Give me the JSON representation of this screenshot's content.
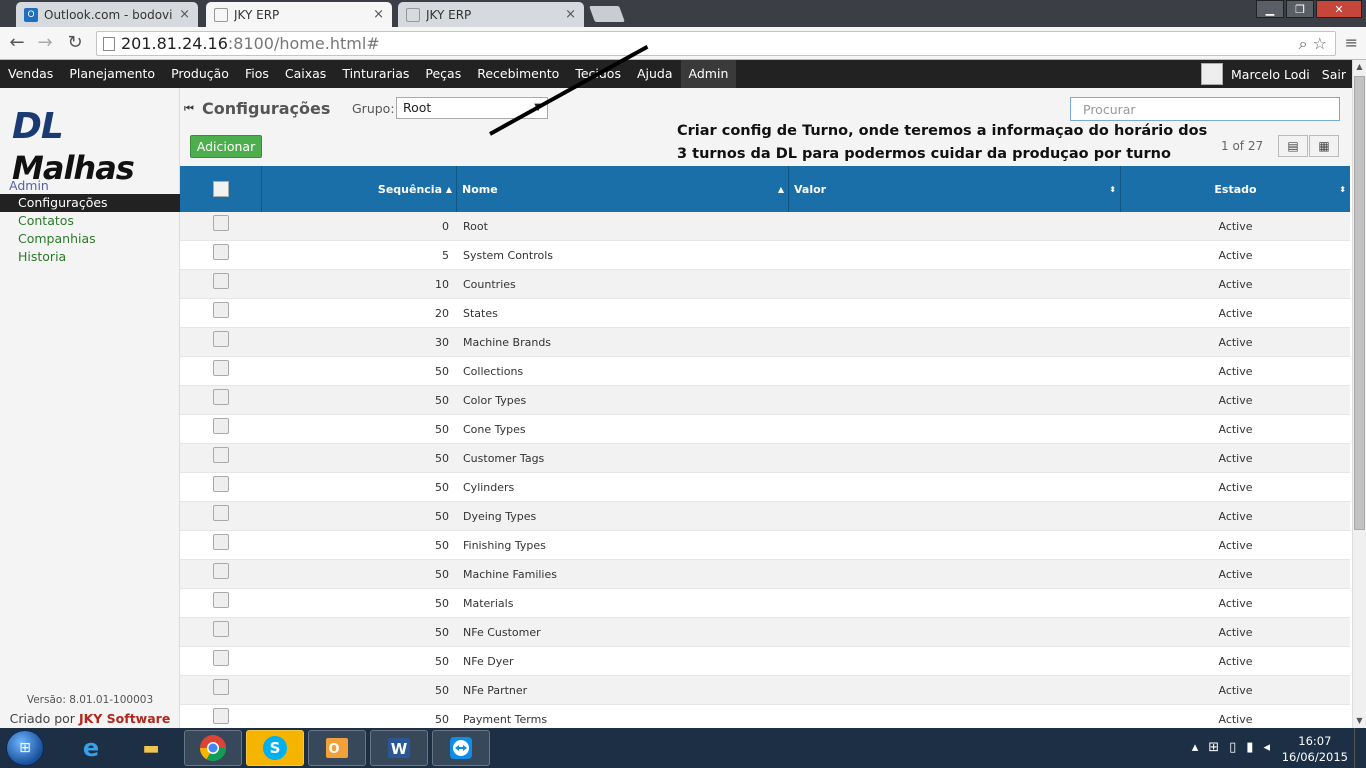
{
  "browser": {
    "tabs": [
      {
        "label": "Outlook.com - bodovisk@",
        "icon": "outlook-icon",
        "active": false
      },
      {
        "label": "JKY ERP",
        "icon": "page-icon",
        "active": true
      },
      {
        "label": "JKY ERP",
        "icon": "page-icon",
        "active": false
      }
    ],
    "url_host": "201.81.24.16",
    "url_rest": ":8100/home.html#",
    "window_buttons": [
      "minimize",
      "restore",
      "close"
    ]
  },
  "menubar": {
    "items": [
      "Vendas",
      "Planejamento",
      "Produção",
      "Fios",
      "Caixas",
      "Tinturarias",
      "Peças",
      "Recebimento",
      "Tecidos",
      "Ajuda",
      "Admin"
    ],
    "active": "Admin",
    "user_name": "Marcelo Lodi",
    "logout": "Sair"
  },
  "sidebar": {
    "logo_a": "DL",
    "logo_b": "Malhas",
    "group": "Admin",
    "items": [
      "Configurações",
      "Contatos",
      "Companhias",
      "Historia"
    ],
    "active": "Configurações",
    "version": "Versão: 8.01.01-100003",
    "credit_prefix": "Criado por",
    "credit_brand": "JKY Software"
  },
  "header": {
    "title": "Configurações",
    "group_label": "Grupo:",
    "group_value": "Root",
    "search_placeholder": "Procurar",
    "add_label": "Adicionar",
    "pager": "1 of 27"
  },
  "annotation": {
    "line1": "Criar config de Turno, onde teremos a informaçao do horário dos",
    "line2": "3 turnos da DL para podermos cuidar da produçao por turno"
  },
  "table": {
    "headers": {
      "sequence": "Sequência",
      "name": "Nome",
      "value": "Valor",
      "status": "Estado"
    },
    "rows": [
      {
        "seq": "0",
        "name": "Root",
        "value": "",
        "status": "Active"
      },
      {
        "seq": "5",
        "name": "System Controls",
        "value": "",
        "status": "Active"
      },
      {
        "seq": "10",
        "name": "Countries",
        "value": "",
        "status": "Active"
      },
      {
        "seq": "20",
        "name": "States",
        "value": "",
        "status": "Active"
      },
      {
        "seq": "30",
        "name": "Machine Brands",
        "value": "",
        "status": "Active"
      },
      {
        "seq": "50",
        "name": "Collections",
        "value": "",
        "status": "Active"
      },
      {
        "seq": "50",
        "name": "Color Types",
        "value": "",
        "status": "Active"
      },
      {
        "seq": "50",
        "name": "Cone Types",
        "value": "",
        "status": "Active"
      },
      {
        "seq": "50",
        "name": "Customer Tags",
        "value": "",
        "status": "Active"
      },
      {
        "seq": "50",
        "name": "Cylinders",
        "value": "",
        "status": "Active"
      },
      {
        "seq": "50",
        "name": "Dyeing Types",
        "value": "",
        "status": "Active"
      },
      {
        "seq": "50",
        "name": "Finishing Types",
        "value": "",
        "status": "Active"
      },
      {
        "seq": "50",
        "name": "Machine Families",
        "value": "",
        "status": "Active"
      },
      {
        "seq": "50",
        "name": "Materials",
        "value": "",
        "status": "Active"
      },
      {
        "seq": "50",
        "name": "NFe Customer",
        "value": "",
        "status": "Active"
      },
      {
        "seq": "50",
        "name": "NFe Dyer",
        "value": "",
        "status": "Active"
      },
      {
        "seq": "50",
        "name": "NFe Partner",
        "value": "",
        "status": "Active"
      },
      {
        "seq": "50",
        "name": "Payment Terms",
        "value": "",
        "status": "Active"
      }
    ]
  },
  "taskbar": {
    "apps": [
      "internet-explorer-icon",
      "file-explorer-icon",
      "chrome-icon",
      "skype-icon",
      "outlook-icon",
      "word-icon",
      "teamviewer-icon"
    ],
    "time": "16:07",
    "date": "16/06/2015"
  },
  "colors": {
    "menubar_bg": "#222222",
    "table_header_bg": "#1a6fa8",
    "add_button_bg": "#4cae4c",
    "sidebar_link": "#2c7a2c",
    "logo_blue": "#1a3a73"
  }
}
